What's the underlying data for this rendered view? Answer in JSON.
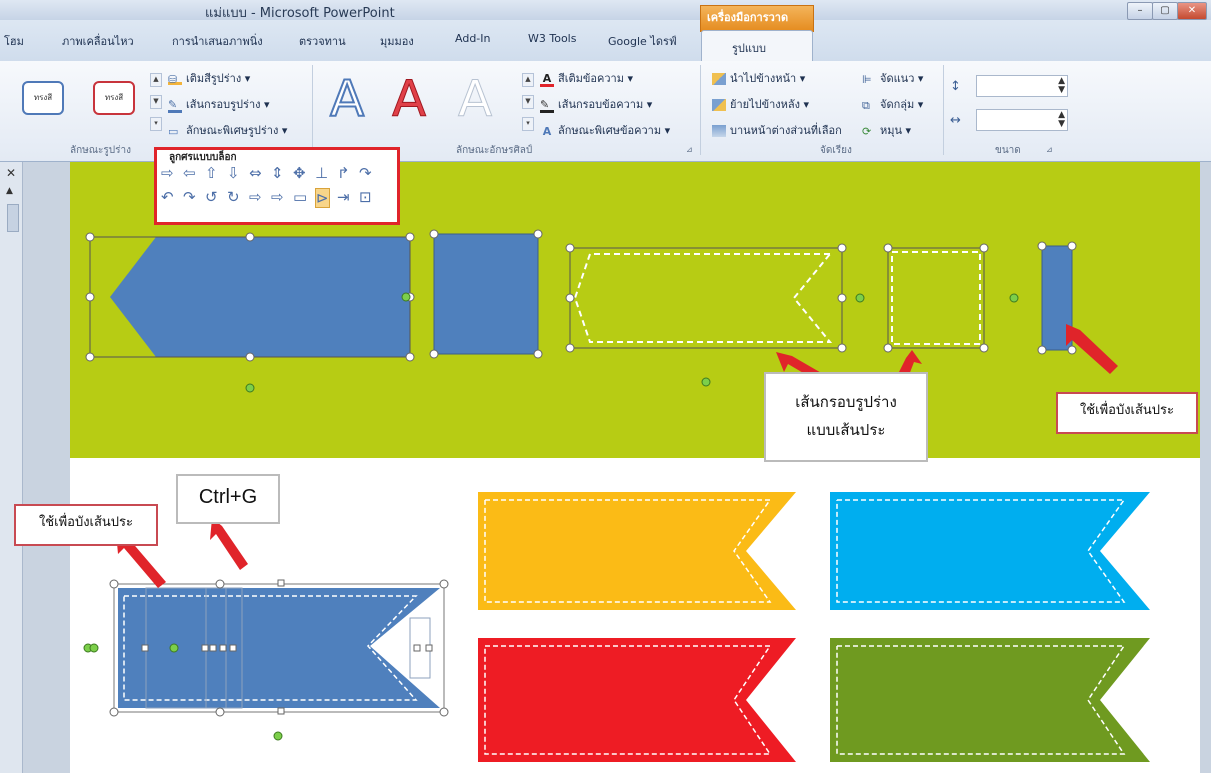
{
  "window": {
    "title": "แม่แบบ - Microsoft PowerPoint",
    "tool_context": "เครื่องมือการวาด",
    "controls": [
      "–",
      "▢",
      "✕"
    ]
  },
  "tabs": [
    {
      "label": "โฮม"
    },
    {
      "label": "ภาพเคลื่อนไหว"
    },
    {
      "label": "การนำเสนอภาพนิ่ง"
    },
    {
      "label": "ตรวจทาน"
    },
    {
      "label": "มุมมอง"
    },
    {
      "label": "Add-In"
    },
    {
      "label": "W3 Tools"
    },
    {
      "label": "Google ไดรฟ์"
    }
  ],
  "active_tab": "รูปแบบ",
  "ribbon": {
    "shape_styles": {
      "swatch_label": "ทรงสี",
      "fill": "เติมสีรูปร่าง ▾",
      "outline": "เส้นกรอบรูปร่าง ▾",
      "effects": "ลักษณะพิเศษรูปร่าง ▾",
      "group_label": "ลักษณะรูปร่าง"
    },
    "wordart": {
      "letter": "A",
      "text_fill": "สีเติมข้อความ ▾",
      "text_outline": "เส้นกรอบข้อความ ▾",
      "text_effects": "ลักษณะพิเศษข้อความ ▾",
      "group_label": "ลักษณะอักษรศิลป์"
    },
    "arrange": {
      "bring_forward": "นำไปข้างหน้า ▾",
      "send_backward": "ย้ายไปข้างหลัง ▾",
      "selection_pane": "บานหน้าต่างส่วนที่เลือก",
      "align": "จัดแนว ▾",
      "group": "จัดกลุ่ม ▾",
      "rotate": "หมุน ▾",
      "group_label": "จัดเรียง"
    },
    "size": {
      "height_value": "",
      "width_value": "",
      "group_label": "ขนาด"
    }
  },
  "shapes_panel": {
    "title": "ลูกศรแบบบล็อก",
    "row1": [
      "⇨",
      "⇦",
      "⇧",
      "⇩",
      "⇔",
      "⇕",
      "✥",
      "⊥",
      "↱",
      "↷"
    ],
    "row2": [
      "↶",
      "↷",
      "↺",
      "↻",
      "⇨",
      "⇨",
      "▭",
      "⊳",
      "⇥",
      "⊡"
    ]
  },
  "annotations": {
    "dashed_outline": "เส้นกรอบรูปร่าง\nแบบเส้นประ",
    "dashed_outline_line1": "เส้นกรอบรูปร่าง",
    "dashed_outline_line2": "แบบเส้นประ",
    "hide_dash_right": "ใช้เพื่อบังเส้นประ",
    "hide_dash_left": "ใช้เพื่อบังเส้นประ",
    "shortcut": "Ctrl+G"
  },
  "colors": {
    "band": "#b7cc14",
    "shape_blue": "#4f80bd",
    "banner_yellow": "#fbbb16",
    "banner_cyan": "#00aeef",
    "banner_red": "#ee1c24",
    "banner_green": "#6f9a20",
    "callout_border": "#c84a52",
    "arrow_red": "#e0242a"
  }
}
